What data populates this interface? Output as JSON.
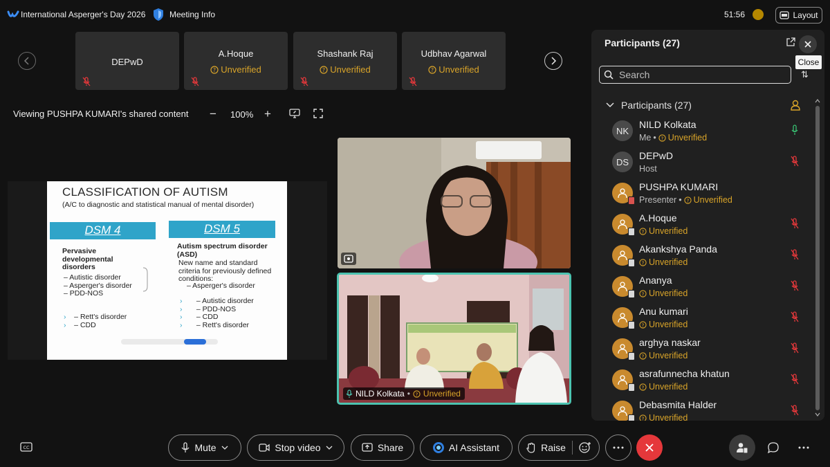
{
  "topbar": {
    "meeting_title": "International Asperger's Day 2026",
    "meeting_info": "Meeting Info",
    "timer": "51:56",
    "layout_label": "Layout"
  },
  "strip": {
    "tiles": [
      {
        "name": "DEPwD",
        "status": ""
      },
      {
        "name": "A.Hoque",
        "status": "Unverified"
      },
      {
        "name": "Shashank Raj",
        "status": "Unverified"
      },
      {
        "name": "Udbhav Agarwal",
        "status": "Unverified"
      }
    ]
  },
  "share": {
    "viewing": "Viewing PUSHPA KUMARI's shared content",
    "zoom_minus": "−",
    "zoom_level": "100%",
    "zoom_plus": "+"
  },
  "slide": {
    "title": "CLASSIFICATION OF AUTISM",
    "subtitle": "(A/C to diagnostic and statistical manual of mental disorder)",
    "dsm4": "DSM 4",
    "dsm5": "DSM 5",
    "left_heading": "Pervasive developmental disorders",
    "left_items": [
      "Autistic disorder",
      "Asperger's disorder",
      "PDD-NOS"
    ],
    "left_items2": [
      "Rett's disorder",
      "CDD"
    ],
    "right_heading": "Autism spectrum disorder (ASD)",
    "right_desc": "New name and standard criteria for previously defined conditions:",
    "right_item1": "– Asperger's disorder",
    "right_items": [
      "– Autistic disorder",
      "– PDD-NOS",
      "– CDD",
      "– Rett's disorder"
    ]
  },
  "video_self": {
    "name": "NILD Kolkata",
    "status": "Unverified"
  },
  "panel": {
    "title": "Participants (27)",
    "close_tooltip": "Close",
    "search_placeholder": "Search",
    "list_header": "Participants (27)",
    "participants": [
      {
        "initials": "NK",
        "name": "NILD Kolkata",
        "role": "Me",
        "status": "Unverified",
        "mic": "on"
      },
      {
        "initials": "DS",
        "name": "DEPwD",
        "role": "Host",
        "status": "",
        "mic": "muted"
      },
      {
        "initials": "",
        "name": "PUSHPA KUMARI",
        "role": "Presenter",
        "status": "Unverified",
        "mic": "none"
      },
      {
        "initials": "",
        "name": "A.Hoque",
        "role": "",
        "status": "Unverified",
        "mic": "muted"
      },
      {
        "initials": "",
        "name": "Akankshya Panda",
        "role": "",
        "status": "Unverified",
        "mic": "muted"
      },
      {
        "initials": "",
        "name": "Ananya",
        "role": "",
        "status": "Unverified",
        "mic": "muted"
      },
      {
        "initials": "",
        "name": "Anu kumari",
        "role": "",
        "status": "Unverified",
        "mic": "muted"
      },
      {
        "initials": "",
        "name": "arghya naskar",
        "role": "",
        "status": "Unverified",
        "mic": "muted"
      },
      {
        "initials": "",
        "name": "asrafunnecha khatun",
        "role": "",
        "status": "Unverified",
        "mic": "muted"
      },
      {
        "initials": "",
        "name": "Debasmita Halder",
        "role": "",
        "status": "Unverified",
        "mic": "muted"
      }
    ]
  },
  "controls": {
    "mute": "Mute",
    "stop_video": "Stop video",
    "share": "Share",
    "ai_assistant": "AI Assistant",
    "raise": "Raise"
  },
  "colors": {
    "background": "#121212",
    "unverified": "#d9a429",
    "end_call": "#e5383b",
    "active_speaker": "#4cc3b0"
  }
}
